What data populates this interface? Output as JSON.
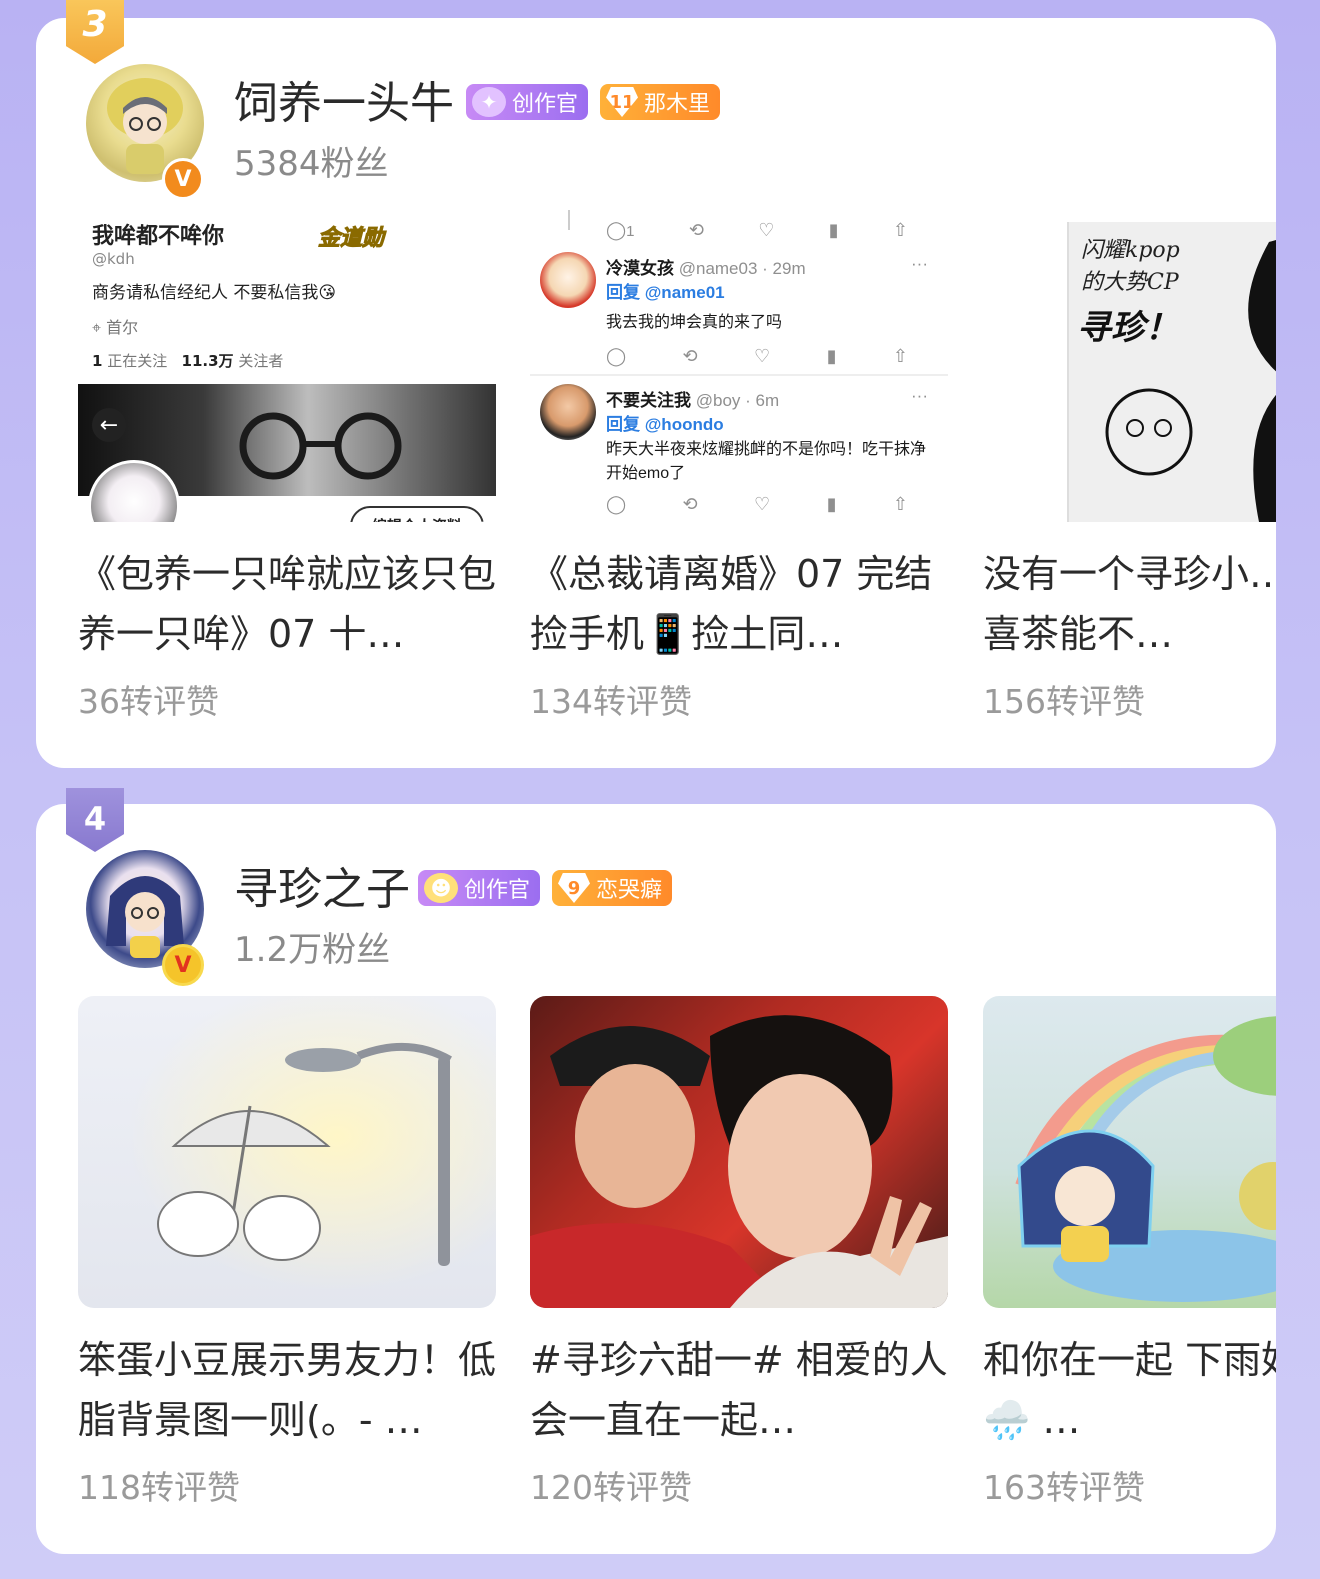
{
  "ranks": [
    {
      "rank": "3",
      "name": "饲养一头牛",
      "creator_tag": "创作官",
      "level_num": "11",
      "level_tag": "那木里",
      "fans": "5384粉丝",
      "posts": [
        {
          "title": "《包养一只哞就应该只包养一只哞》07 十…",
          "stats": "36转评赞",
          "profile": {
            "name": "我哞都不哞你",
            "medal": "金道勋",
            "handle": "@kdh",
            "bio": "商务请私信经纪人 不要私信我😘",
            "location": "首尔",
            "following_num": "1",
            "following_label": "正在关注",
            "followers_num": "11.3万",
            "followers_label": "关注者",
            "edit_label": "编辑个人资料"
          }
        },
        {
          "title": "《总裁请离婚》07 完结 捡手机📱捡土同…",
          "stats": "134转评赞",
          "tweets": {
            "top_reply_count": "1",
            "t1_name": "冷漠女孩",
            "t1_handle": "@name03 · 29m",
            "t1_reply_prefix": "回复",
            "t1_reply_to": "@name01",
            "t1_text": "我去我的坤会真的来了吗",
            "t2_name": "不要关注我",
            "t2_handle": "@boy · 6m",
            "t2_reply_prefix": "回复",
            "t2_reply_to": "@hoondo",
            "t2_text": "昨天大半夜来炫耀挑衅的不是你吗！吃干抹净开始emo了"
          }
        },
        {
          "title": "没有一个寻珍小…到这杯喜茶能不…",
          "stats": "156转评赞",
          "sketch_text_1": "闪耀kpop",
          "sketch_text_2": "的大势CP",
          "sketch_text_3": "寻珍！"
        }
      ]
    },
    {
      "rank": "4",
      "name": "寻珍之子",
      "creator_tag": "创作官",
      "level_num": "9",
      "level_tag": "恋哭癖",
      "fans": "1.2万粉丝",
      "posts": [
        {
          "title": "笨蛋小豆展示男友力！低脂背景图一则(。- …",
          "stats": "118转评赞"
        },
        {
          "title": "#寻珍六甜一# 相爱的人会一直在一起…",
          "stats": "120转评赞"
        },
        {
          "title": "和你在一起 下雨好天气🌧️ …",
          "stats": "163转评赞"
        }
      ]
    }
  ],
  "colors": {
    "creator_tag": "#9b6ef0",
    "level_tag": "#ff8a2a",
    "rank3": "#f5b13f",
    "rank4": "#8d7fd3"
  }
}
